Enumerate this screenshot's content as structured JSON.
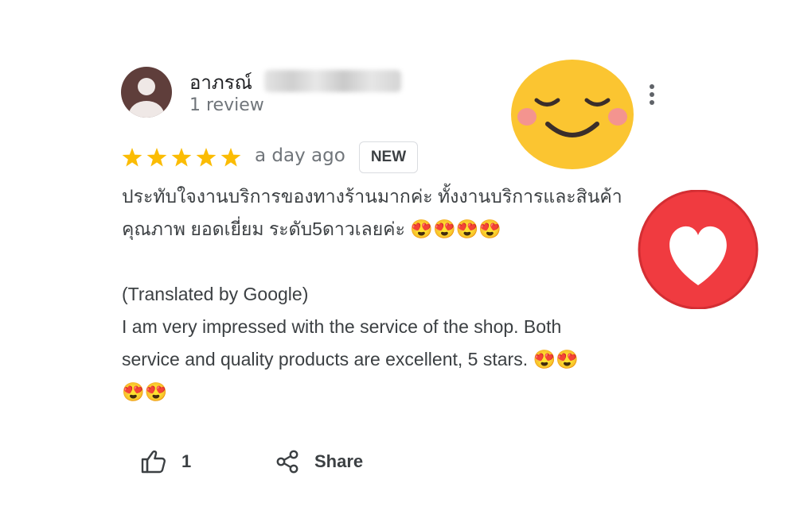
{
  "review": {
    "reviewer_name": "อาภรณ์",
    "review_count": "1 review",
    "rating": 5,
    "rating_max": 5,
    "date": "a day ago",
    "badge": "NEW",
    "text": "ประทับใจงานบริการของทางร้านมากค่ะ ทั้งงานบริการและสินค้า\nคุณภาพ ยอดเยี่ยม ระดับ5ดาวเลยค่ะ 😍😍😍😍\n\n(Translated by Google)\nI am very impressed with the service of the shop. Both\nservice and quality products are excellent, 5 stars. 😍😍\n😍😍"
  },
  "actions": {
    "like_count": "1",
    "share_label": "Share"
  },
  "icons": {
    "avatar": "person-avatar-icon",
    "more": "more-vert-icon",
    "star": "star-icon",
    "like": "thumb-up-icon",
    "share": "share-icon"
  },
  "colors": {
    "star": "#fbbc04",
    "avatar_bg": "#5f3e3b",
    "heart_circle": "#f03b40",
    "smiley": "#fbc531"
  }
}
